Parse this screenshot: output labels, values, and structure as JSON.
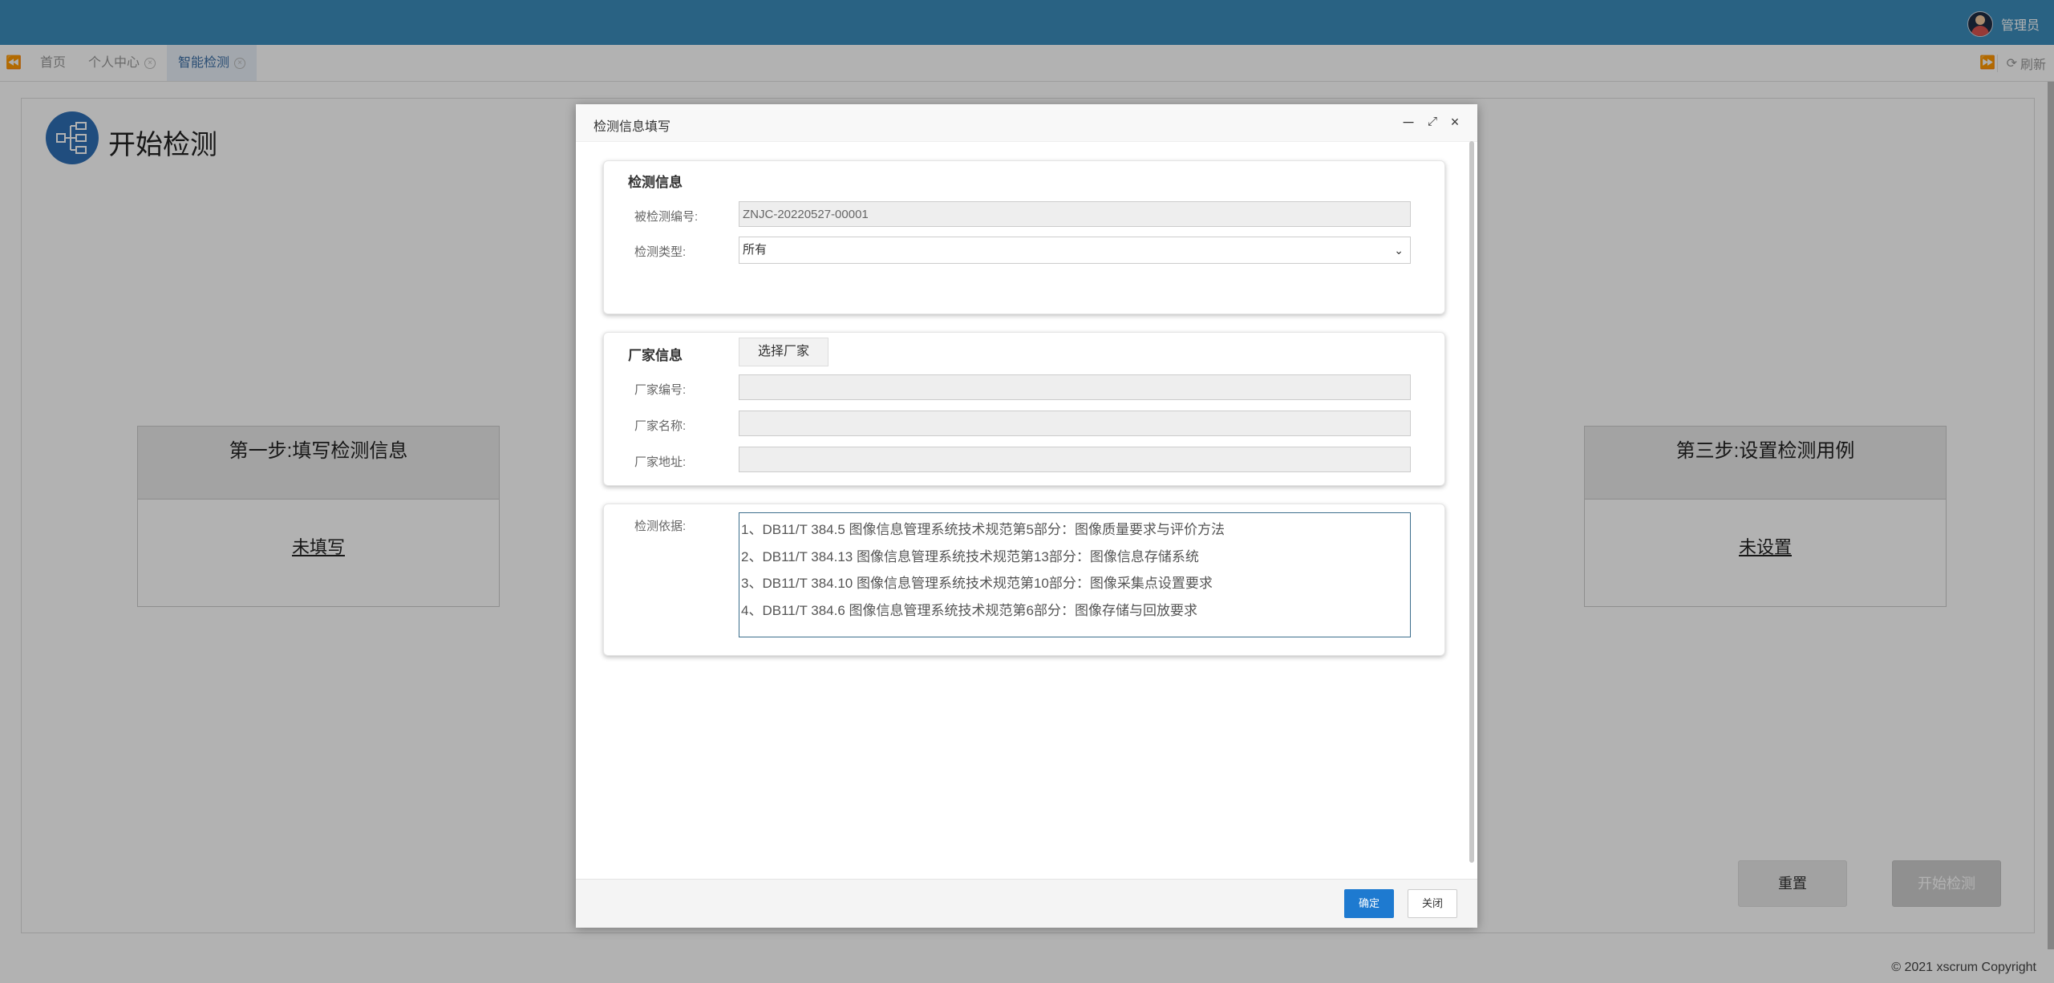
{
  "header": {
    "user_name": "管理员",
    "avatar": "user-avatar"
  },
  "tabbar": {
    "tabs": [
      {
        "label": "首页"
      },
      {
        "label": "个人中心"
      },
      {
        "label": "智能检测"
      }
    ],
    "refresh_label": "刷新",
    "icons": {
      "prev": "double-chevron-left-icon",
      "next": "double-chevron-right-icon",
      "refresh": "refresh-icon",
      "close": "close-circle-icon"
    }
  },
  "page": {
    "title": "开始检测",
    "step1": {
      "title": "第一步:填写检测信息",
      "status": "未填写"
    },
    "step3": {
      "title": "第三步:设置检测用例",
      "status": "未设置"
    },
    "reset_label": "重置",
    "start_label": "开始检测"
  },
  "footer": {
    "copyright": "© 2021 xscrum Copyright"
  },
  "dialog": {
    "title": "检测信息填写",
    "detection": {
      "section_title": "检测信息",
      "code_label": "被检测编号:",
      "code_value": "ZNJC-20220527-00001",
      "type_label": "检测类型:",
      "type_value": "所有"
    },
    "vendor": {
      "section_title": "厂家信息",
      "choose_label": "选择厂家",
      "code_label": "厂家编号:",
      "name_label": "厂家名称:",
      "address_label": "厂家地址:"
    },
    "basis": {
      "label": "检测依据:",
      "lines": [
        "1、DB11/T 384.5 图像信息管理系统技术规范第5部分：图像质量要求与评价方法",
        "2、DB11/T 384.13 图像信息管理系统技术规范第13部分：图像信息存储系统",
        "3、DB11/T 384.10 图像信息管理系统技术规范第10部分：图像采集点设置要求",
        "4、DB11/T 384.6 图像信息管理系统技术规范第6部分：图像存储与回放要求"
      ]
    },
    "ok_label": "确定",
    "close_label": "关闭"
  }
}
